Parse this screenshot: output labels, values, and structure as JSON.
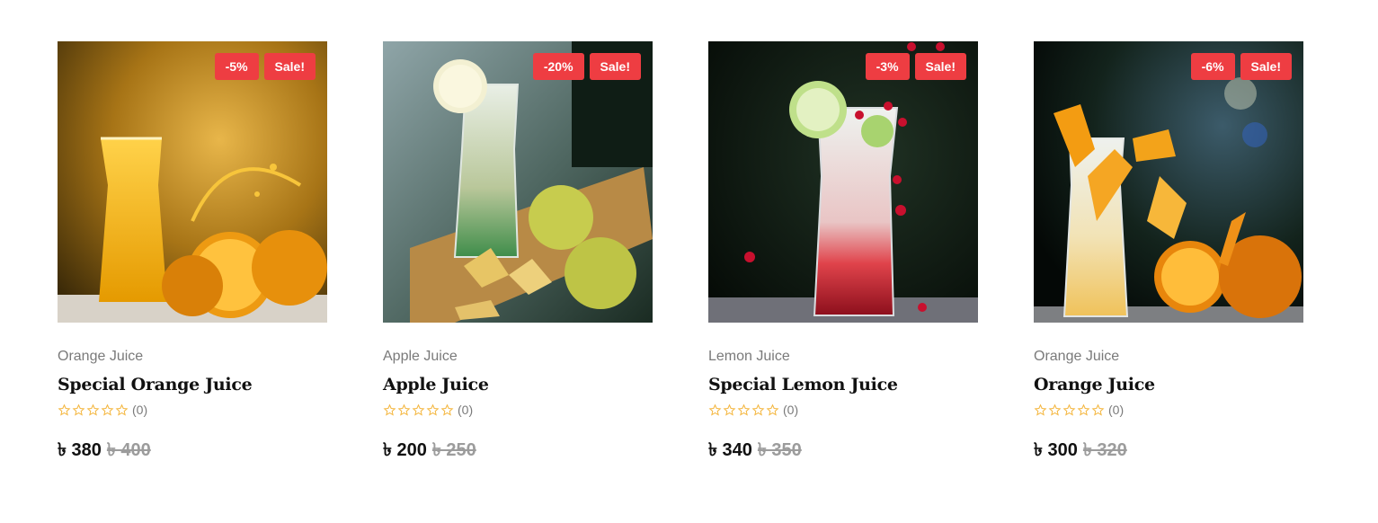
{
  "colors": {
    "badge": "#ee3d42",
    "star": "#f4b63e",
    "title": "#111111",
    "muted": "#7a7a7a",
    "old_price": "#9c9c9c"
  },
  "products": [
    {
      "discount": "-5%",
      "sale": "Sale!",
      "category": "Orange Juice",
      "name": "Special Orange Juice",
      "rating_count": "(0)",
      "price": "৳ 380",
      "old_price": "৳ 400",
      "image": "orange-juice-glass-photo"
    },
    {
      "discount": "-20%",
      "sale": "Sale!",
      "category": "Apple Juice",
      "name": "Apple Juice",
      "rating_count": "(0)",
      "price": "৳ 200",
      "old_price": "৳ 250",
      "image": "apple-juice-glass-photo"
    },
    {
      "discount": "-3%",
      "sale": "Sale!",
      "category": "Lemon Juice",
      "name": "Special Lemon Juice",
      "rating_count": "(0)",
      "price": "৳ 340",
      "old_price": "৳ 350",
      "image": "lemon-juice-glass-photo"
    },
    {
      "discount": "-6%",
      "sale": "Sale!",
      "category": "Orange Juice",
      "name": "Orange Juice",
      "rating_count": "(0)",
      "price": "৳ 300",
      "old_price": "৳ 320",
      "image": "orange-splash-glass-photo"
    }
  ]
}
